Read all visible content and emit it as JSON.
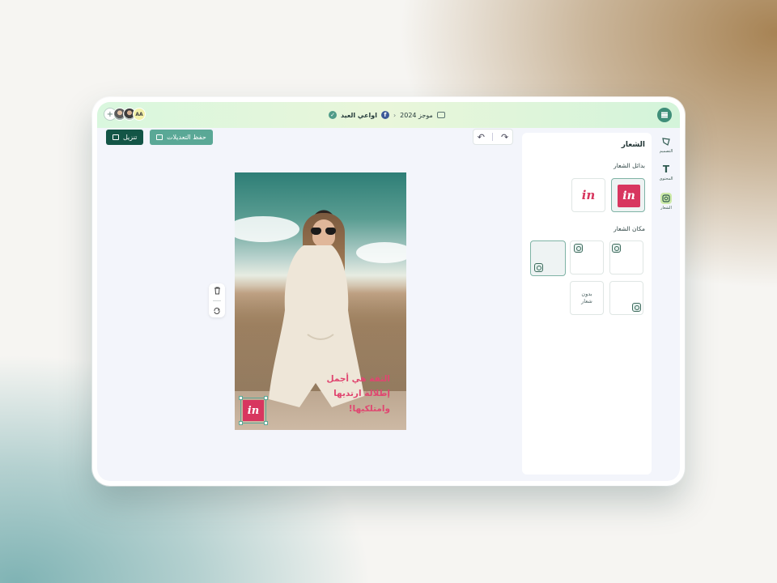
{
  "topbar": {
    "breadcrumb": {
      "folder": "موجز 2024",
      "project": "اواعي العيد"
    },
    "avatars": {
      "initials": "AA"
    }
  },
  "rail": [
    {
      "label": "التصميم"
    },
    {
      "label": "المحتوى"
    },
    {
      "label": "الشعار"
    }
  ],
  "panel": {
    "title": "الشعار",
    "alternatives_label": "بدائل الشعار",
    "position_label": "مكان الشعار",
    "no_logo_label": "بدون شعار"
  },
  "toolbar": {
    "download_label": "تنزيل",
    "save_label": "حفظ التعديلات"
  },
  "canvas": {
    "quote_lines": [
      "الثقة هي أجمل",
      "إطلالة ارتديها",
      "وامتلكيها!"
    ],
    "logo_text": "in"
  },
  "colors": {
    "accent": "#5aa896",
    "primary_dark": "#135546",
    "brand_logo": "#d8365f",
    "quote_text": "#e04670"
  },
  "icons": {
    "menu": "hamburger-icon",
    "folder": "folder-icon",
    "facebook": "facebook-icon",
    "verified": "check-circle-icon",
    "chevron": "chevron-right-icon",
    "add": "plus-icon",
    "undo": "undo-icon",
    "redo": "redo-icon",
    "delete": "trash-icon",
    "replace": "replace-image-icon",
    "download": "download-icon",
    "save": "save-icon"
  }
}
